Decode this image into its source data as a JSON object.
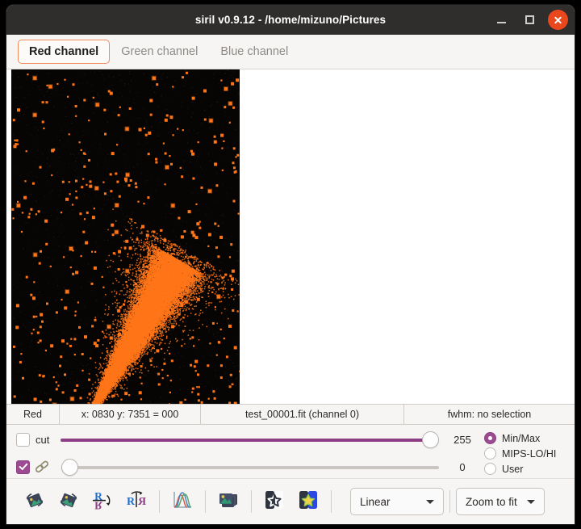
{
  "window": {
    "title": "siril v0.9.12 - /home/mizuno/Pictures",
    "minimize_label": "Minimize",
    "maximize_label": "Maximize",
    "close_label": "Close"
  },
  "tabs": [
    {
      "label": "Red channel",
      "active": true
    },
    {
      "label": "Green channel",
      "active": false
    },
    {
      "label": "Blue channel",
      "active": false
    }
  ],
  "canvas": {
    "background_color": "#070503",
    "star_color": "#ff7518",
    "core_color": "#d9d9d9",
    "description": "Astronomical image: dense orange comet-like plume on black sky with scattered stars"
  },
  "statusbar": {
    "channel": "Red",
    "coordinates": "x: 0830 y: 7351 = 000",
    "filename": "test_00001.fit (channel 0)",
    "fwhm": "fwhm: no selection"
  },
  "sliders": {
    "cut_label": "cut",
    "cut_checked": false,
    "link_checked": true,
    "high": {
      "value": "255",
      "percent": 100
    },
    "low": {
      "value": "0",
      "percent": 0
    }
  },
  "display_mode": {
    "options": [
      {
        "label": "Min/Max",
        "selected": true
      },
      {
        "label": "MIPS-LO/HI",
        "selected": false
      },
      {
        "label": "User",
        "selected": false
      }
    ]
  },
  "toolbar": {
    "buttons": [
      {
        "name": "rotate-left-icon",
        "tooltip": "Rotate left"
      },
      {
        "name": "rotate-right-icon",
        "tooltip": "Rotate right"
      },
      {
        "name": "flip-vertical-icon",
        "tooltip": "Flip vertically"
      },
      {
        "name": "mirror-horizontal-icon",
        "tooltip": "Mirror horizontally"
      },
      {
        "name": "histogram-icon",
        "tooltip": "Histogram transformation"
      },
      {
        "name": "image-stack-icon",
        "tooltip": "Image sequence"
      },
      {
        "name": "star-bw-icon",
        "tooltip": "Negative view"
      },
      {
        "name": "star-color-icon",
        "tooltip": "Color view"
      }
    ],
    "mode_select": "Linear",
    "zoom_select": "Zoom to fit"
  },
  "colors": {
    "titlebar": "#302e2c",
    "accent_orange": "#e8481c",
    "tab_active_border": "#f08b5a",
    "slider_purple": "#8e3e84",
    "panel_bg": "#f6f5f4"
  }
}
